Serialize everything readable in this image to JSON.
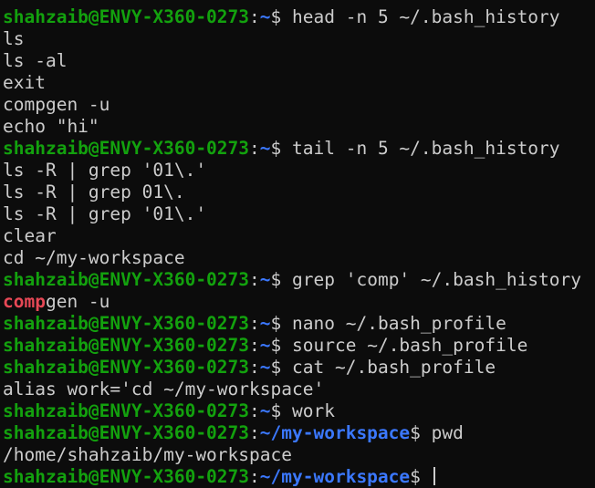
{
  "prompt": {
    "user_host": "shahzaib@ENVY-X360-0273",
    "colon": ":",
    "dollar": "$"
  },
  "lines": [
    {
      "type": "prompt",
      "path": "~",
      "command": "head -n 5 ~/.bash_history"
    },
    {
      "type": "output",
      "text": "ls"
    },
    {
      "type": "output",
      "text": "ls -al"
    },
    {
      "type": "output",
      "text": "exit"
    },
    {
      "type": "output",
      "text": "compgen -u"
    },
    {
      "type": "output",
      "text": "echo \"hi\""
    },
    {
      "type": "prompt",
      "path": "~",
      "command": "tail -n 5 ~/.bash_history"
    },
    {
      "type": "output",
      "text": "ls -R | grep '01\\.'"
    },
    {
      "type": "output",
      "text": "ls -R | grep 01\\."
    },
    {
      "type": "output",
      "text": "ls -R | grep '01\\.'"
    },
    {
      "type": "output",
      "text": "clear"
    },
    {
      "type": "output",
      "text": "cd ~/my-workspace"
    },
    {
      "type": "prompt",
      "path": "~",
      "command": "grep 'comp' ~/.bash_history"
    },
    {
      "type": "match",
      "match": "comp",
      "rest": "gen -u"
    },
    {
      "type": "prompt",
      "path": "~",
      "command": "nano ~/.bash_profile"
    },
    {
      "type": "prompt",
      "path": "~",
      "command": "source ~/.bash_profile"
    },
    {
      "type": "prompt",
      "path": "~",
      "command": "cat ~/.bash_profile"
    },
    {
      "type": "output",
      "text": "alias work='cd ~/my-workspace'"
    },
    {
      "type": "prompt",
      "path": "~",
      "command": "work"
    },
    {
      "type": "prompt",
      "path": "~/my-workspace",
      "command": "pwd"
    },
    {
      "type": "output",
      "text": "/home/shahzaib/my-workspace"
    },
    {
      "type": "prompt",
      "path": "~/my-workspace",
      "command": "",
      "cursor": true
    }
  ],
  "colors": {
    "background": "#0c0c0c",
    "foreground": "#cccccc",
    "user_host": "#13a10e",
    "path": "#3b78ff",
    "grep_match": "#e74856"
  }
}
